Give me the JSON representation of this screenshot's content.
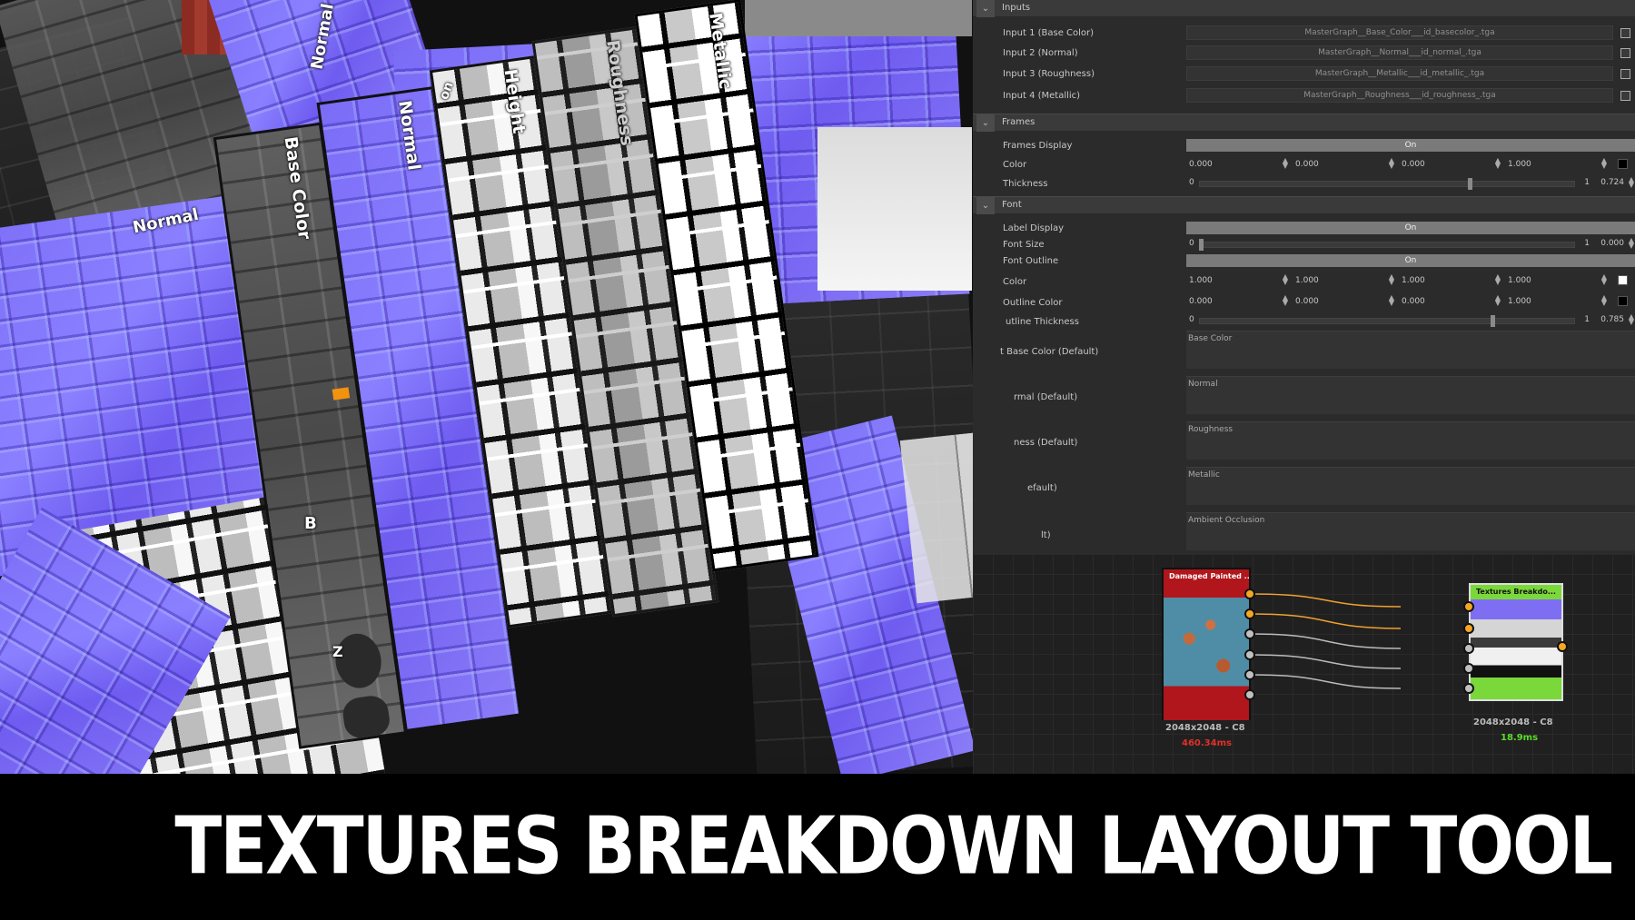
{
  "strip_labels": {
    "base_color": "Base Color",
    "normal": "Normal",
    "height": "Height",
    "roughness": "Roughness",
    "metallic": "Metallic",
    "normal_back": "Normal",
    "normal_left": "Normal",
    "normal_partial": "on",
    "b_partial": "B",
    "z_partial": "Z"
  },
  "panel": {
    "inputs": {
      "title": "Inputs",
      "rows": [
        {
          "label": "Input 1 (Base Color)",
          "value": "MasterGraph__Base_Color___id_basecolor_.tga"
        },
        {
          "label": "Input 2 (Normal)",
          "value": "MasterGraph__Normal___id_normal_.tga"
        },
        {
          "label": "Input 3 (Roughness)",
          "value": "MasterGraph__Metallic___id_metallic_.tga"
        },
        {
          "label": "Input 4 (Metallic)",
          "value": "MasterGraph__Roughness___id_roughness_.tga"
        }
      ]
    },
    "frames": {
      "title": "Frames",
      "display_label": "Frames Display",
      "display_value": "On",
      "color_label": "Color",
      "color_values": [
        "0.000",
        "0.000",
        "0.000",
        "1.000"
      ],
      "color_swatch": "#000000",
      "thickness_label": "Thickness",
      "thickness_min": "0",
      "thickness_max": "1",
      "thickness_value": "0.724",
      "thickness_fraction": 0.724
    },
    "font": {
      "title": "Font",
      "label_display_label": "Label Display",
      "label_display_value": "On",
      "font_size_label": "Font Size",
      "font_size_min": "0",
      "font_size_max": "1",
      "font_size_value": "0.000",
      "font_size_fraction": 0.0,
      "outline_label": "Font Outline",
      "outline_value": "On",
      "color_label": "Color",
      "color_values": [
        "1.000",
        "1.000",
        "1.000",
        "1.000"
      ],
      "color_swatch": "#ffffff",
      "outline_color_label": "Outline Color",
      "outline_color_values": [
        "0.000",
        "0.000",
        "0.000",
        "1.000"
      ],
      "outline_color_swatch": "#000000",
      "outline_thickness_label": "utline Thickness",
      "outline_thickness_min": "0",
      "outline_thickness_max": "1",
      "outline_thickness_value": "0.785",
      "outline_thickness_fraction": 0.785
    },
    "labels": [
      {
        "label": "t Base Color (Default)",
        "value": "Base Color"
      },
      {
        "label": "rmal (Default)",
        "value": "Normal"
      },
      {
        "label": "ness (Default)",
        "value": "Roughness"
      },
      {
        "label": "efault)",
        "value": "Metallic"
      },
      {
        "label": "lt)",
        "value": "Ambient Occlusion"
      }
    ]
  },
  "graph": {
    "node_left": {
      "title": "Damaged Painted ...",
      "resolution": "2048x2048 - C8",
      "time": "460.34ms"
    },
    "node_right": {
      "title": "Textures Breakdo...",
      "resolution": "2048x2048 - C8",
      "time": "18.9ms"
    },
    "colors": {
      "port_active": "#f5a623",
      "port_idle": "#c0c0c0",
      "time_slow": "#e0302a",
      "time_fast": "#5bdc2a"
    }
  },
  "banner": {
    "title": "TEXTURES BREAKDOWN LAYOUT TOOL"
  }
}
